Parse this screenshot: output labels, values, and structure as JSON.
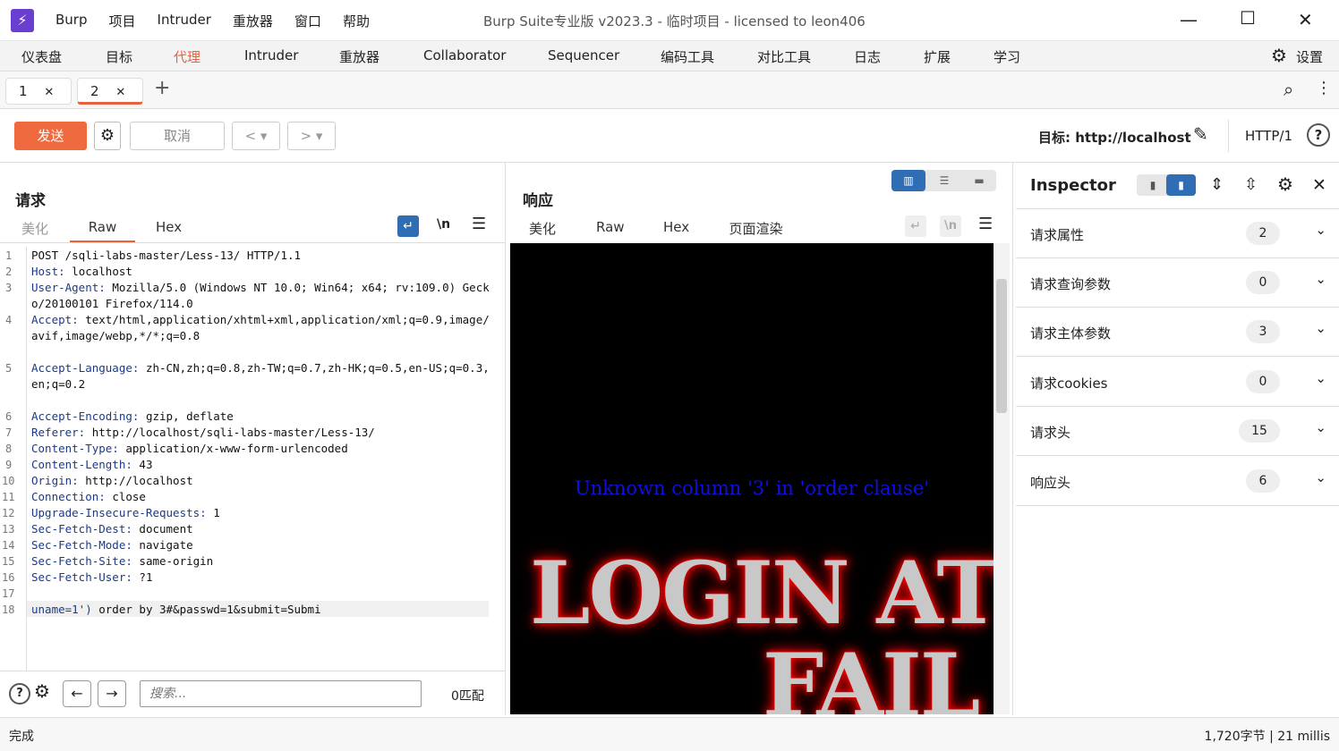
{
  "app": {
    "logo": "⚡",
    "menu": [
      "Burp",
      "项目",
      "Intruder",
      "重放器",
      "窗口",
      "帮助"
    ],
    "title": "Burp Suite专业版  v2023.3 - 临时项目 - licensed to leon406"
  },
  "main_tabs": [
    "仪表盘",
    "目标",
    "代理",
    "Intruder",
    "重放器",
    "Collaborator",
    "Sequencer",
    "编码工具",
    "对比工具",
    "日志",
    "扩展",
    "学习"
  ],
  "settings_label": "设置",
  "repeater_tabs": [
    {
      "label": "1"
    },
    {
      "label": "2"
    }
  ],
  "toolbar": {
    "send": "发送",
    "cancel": "取消",
    "target": "目标: http://localhost",
    "http_version": "HTTP/1"
  },
  "request": {
    "title": "请求",
    "view_tabs": [
      "美化",
      "Raw",
      "Hex"
    ],
    "lines": [
      {
        "n": "1",
        "text": "POST /sqli-labs-master/Less-13/ HTTP/1.1",
        "key": ""
      },
      {
        "n": "2",
        "key": "Host:",
        "text": " localhost"
      },
      {
        "n": "3",
        "key": "User-Agent:",
        "text": " Mozilla/5.0 (Windows NT 10.0; Win64; x64; rv:109.0) Gecko/20100101 Firefox/114.0"
      },
      {
        "n": "4",
        "key": "Accept:",
        "text": " text/html,application/xhtml+xml,application/xml;q=0.9,image/avif,image/webp,*/*;q=0.8"
      },
      {
        "n": "5",
        "key": "Accept-Language:",
        "text": " zh-CN,zh;q=0.8,zh-TW;q=0.7,zh-HK;q=0.5,en-US;q=0.3,en;q=0.2"
      },
      {
        "n": "6",
        "key": "Accept-Encoding:",
        "text": " gzip, deflate"
      },
      {
        "n": "7",
        "key": "Referer:",
        "text": " http://localhost/sqli-labs-master/Less-13/"
      },
      {
        "n": "8",
        "key": "Content-Type:",
        "text": " application/x-www-form-urlencoded"
      },
      {
        "n": "9",
        "key": "Content-Length:",
        "text": " 43"
      },
      {
        "n": "10",
        "key": "Origin:",
        "text": " http://localhost"
      },
      {
        "n": "11",
        "key": "Connection:",
        "text": " close"
      },
      {
        "n": "12",
        "key": "Upgrade-Insecure-Requests:",
        "text": " 1"
      },
      {
        "n": "13",
        "key": "Sec-Fetch-Dest:",
        "text": " document"
      },
      {
        "n": "14",
        "key": "Sec-Fetch-Mode:",
        "text": " navigate"
      },
      {
        "n": "15",
        "key": "Sec-Fetch-Site:",
        "text": " same-origin"
      },
      {
        "n": "16",
        "key": "Sec-Fetch-User:",
        "text": " ?1"
      },
      {
        "n": "17",
        "key": "",
        "text": ""
      },
      {
        "n": "18",
        "key": "uname=1')",
        "text": " order by 3#&passwd=1&submit=Submi"
      }
    ],
    "search_placeholder": "搜索...",
    "matches": "0匹配"
  },
  "response": {
    "title": "响应",
    "view_tabs": [
      "美化",
      "Raw",
      "Hex",
      "页面渲染"
    ],
    "error_text": "Unknown column '3' in 'order clause'",
    "banner_line1": "LOGIN AT",
    "banner_line2": "FAIL"
  },
  "inspector": {
    "title": "Inspector",
    "rows": [
      {
        "label": "请求属性",
        "count": "2"
      },
      {
        "label": "请求查询参数",
        "count": "0"
      },
      {
        "label": "请求主体参数",
        "count": "3"
      },
      {
        "label": "请求cookies",
        "count": "0"
      },
      {
        "label": "请求头",
        "count": "15"
      },
      {
        "label": "响应头",
        "count": "6"
      }
    ]
  },
  "status": {
    "left": "完成",
    "right": "1,720字节 | 21 millis"
  }
}
